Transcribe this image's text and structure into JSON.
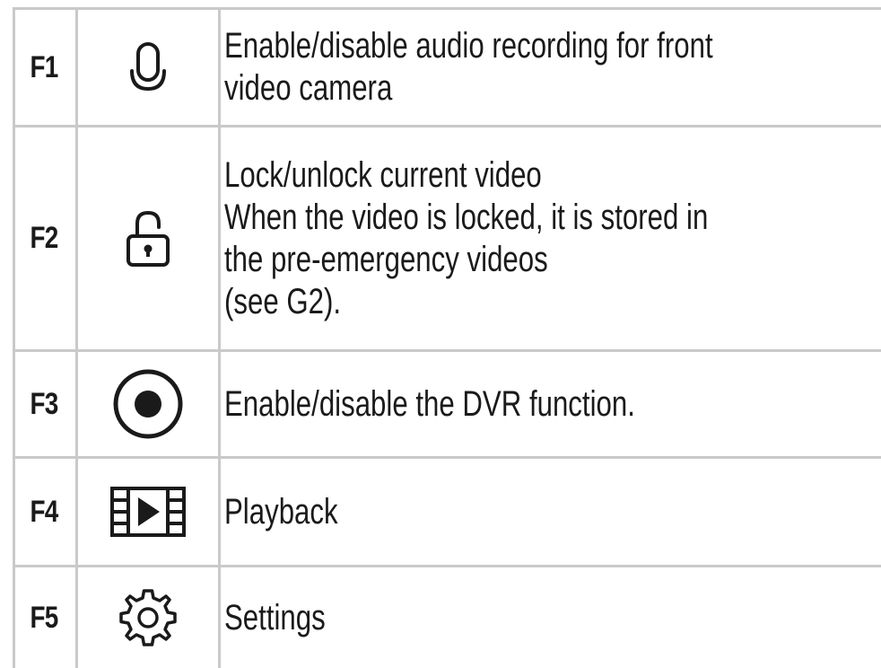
{
  "rows": [
    {
      "code": "F1",
      "icon": "microphone-icon",
      "description": "Enable/disable audio recording for front\nvideo camera"
    },
    {
      "code": "F2",
      "icon": "unlock-icon",
      "description": "Lock/unlock current video\nWhen the video is locked, it is stored in\nthe pre-emergency videos\n(see G2)."
    },
    {
      "code": "F3",
      "icon": "record-icon",
      "description": "Enable/disable the DVR function."
    },
    {
      "code": "F4",
      "icon": "playback-film-icon",
      "description": "Playback"
    },
    {
      "code": "F5",
      "icon": "settings-gear-icon",
      "description": "Settings"
    }
  ]
}
